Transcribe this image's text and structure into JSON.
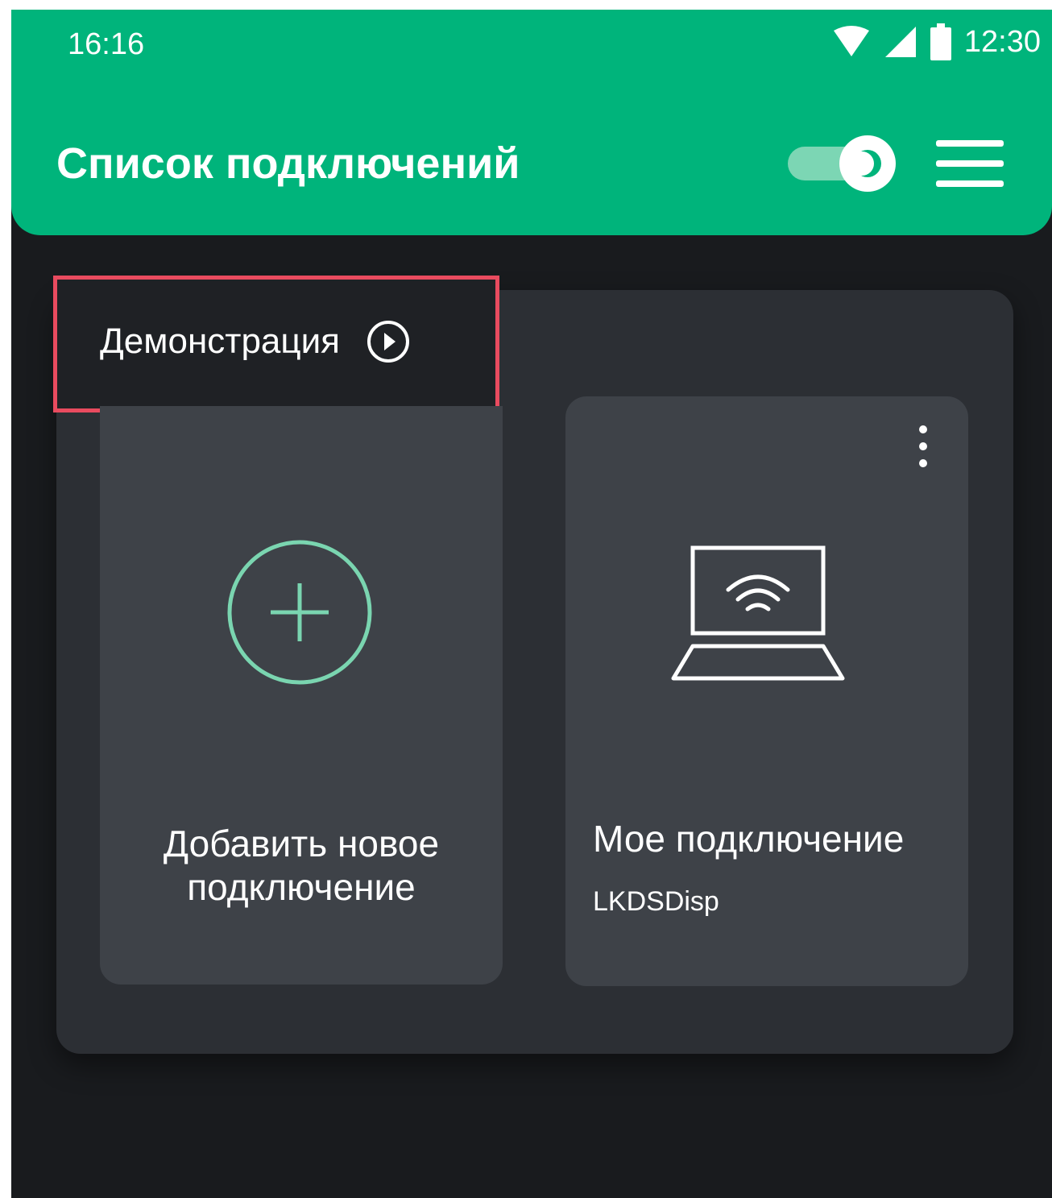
{
  "status_bar": {
    "left_time": "16:16",
    "right_time": "12:30",
    "icons": [
      "wifi-icon",
      "signal-icon",
      "battery-icon"
    ]
  },
  "app_bar": {
    "title": "Список подключений",
    "theme_toggle_icon": "dark-mode-toggle",
    "menu_icon": "hamburger-menu-icon",
    "background_color": "#00b47b"
  },
  "demo": {
    "label": "Демонстрация",
    "icon": "play-circle-icon",
    "highlight_color": "#e94b5f"
  },
  "cards": {
    "add": {
      "line1": "Добавить новое",
      "line2": "подключение",
      "icon": "add-circle-icon",
      "accent_color": "#7ad5b0"
    },
    "connection": {
      "name": "Мое подключение",
      "subtitle": "LKDSDisp",
      "icon": "laptop-wifi-icon",
      "menu_icon": "more-vert-icon"
    }
  }
}
